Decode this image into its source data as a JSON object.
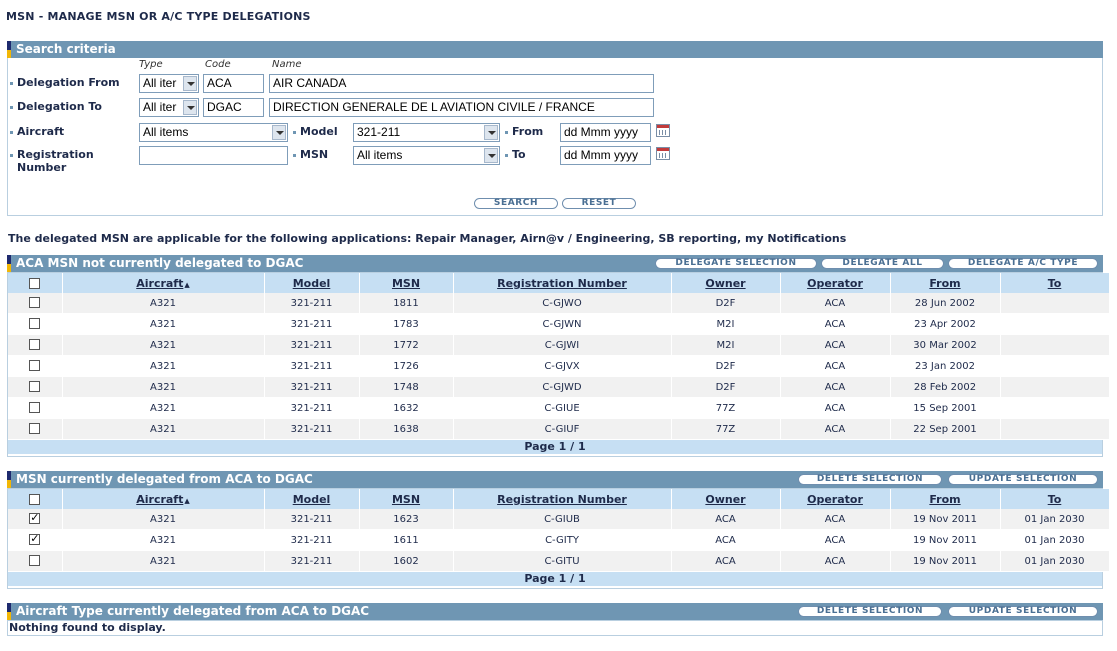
{
  "page_title": "MSN - MANAGE MSN OR A/C TYPE DELEGATIONS",
  "search": {
    "title": "Search criteria",
    "col_type": "Type",
    "col_code": "Code",
    "col_name": "Name",
    "delegation_from_label": "Delegation From",
    "delegation_from_type": "All iter",
    "delegation_from_code": "ACA",
    "delegation_from_name": "AIR CANADA",
    "delegation_to_label": "Delegation To",
    "delegation_to_type": "All iter",
    "delegation_to_code": "DGAC",
    "delegation_to_name": "DIRECTION GENERALE DE L AVIATION CIVILE / FRANCE",
    "aircraft_label": "Aircraft",
    "aircraft_value": "All items",
    "model_label": "Model",
    "model_value": "321-211",
    "from_label": "From",
    "from_placeholder": "dd Mmm yyyy",
    "registration_label_1": "Registration",
    "registration_label_2": "Number",
    "registration_value": "",
    "msn_label": "MSN",
    "msn_value": "All items",
    "to_label": "To",
    "to_placeholder": "dd Mmm yyyy",
    "search_button": "SEARCH",
    "reset_button": "RESET"
  },
  "note": "The delegated MSN are applicable for the following applications: Repair Manager, Airn@v / Engineering, SB reporting, my Notifications",
  "columns": [
    "Aircraft",
    "Model",
    "MSN",
    "Registration Number",
    "Owner",
    "Operator",
    "From",
    "To"
  ],
  "not_delegated": {
    "title": "ACA MSN not currently delegated to DGAC",
    "buttons": [
      "DELEGATE SELECTION",
      "DELEGATE ALL",
      "DELEGATE A/C TYPE"
    ],
    "rows": [
      {
        "checked": false,
        "cells": [
          "A321",
          "321-211",
          "1811",
          "C-GJWO",
          "D2F",
          "ACA",
          "28 Jun 2002",
          ""
        ]
      },
      {
        "checked": false,
        "cells": [
          "A321",
          "321-211",
          "1783",
          "C-GJWN",
          "M2I",
          "ACA",
          "23 Apr 2002",
          ""
        ]
      },
      {
        "checked": false,
        "cells": [
          "A321",
          "321-211",
          "1772",
          "C-GJWI",
          "M2I",
          "ACA",
          "30 Mar 2002",
          ""
        ]
      },
      {
        "checked": false,
        "cells": [
          "A321",
          "321-211",
          "1726",
          "C-GJVX",
          "D2F",
          "ACA",
          "23 Jan 2002",
          ""
        ]
      },
      {
        "checked": false,
        "cells": [
          "A321",
          "321-211",
          "1748",
          "C-GJWD",
          "D2F",
          "ACA",
          "28 Feb 2002",
          ""
        ]
      },
      {
        "checked": false,
        "cells": [
          "A321",
          "321-211",
          "1632",
          "C-GIUE",
          "77Z",
          "ACA",
          "15 Sep 2001",
          ""
        ]
      },
      {
        "checked": false,
        "cells": [
          "A321",
          "321-211",
          "1638",
          "C-GIUF",
          "77Z",
          "ACA",
          "22 Sep 2001",
          ""
        ]
      }
    ],
    "pager": "Page 1 / 1"
  },
  "delegated": {
    "title": "MSN currently delegated from ACA to DGAC",
    "buttons": [
      "DELETE SELECTION",
      "UPDATE SELECTION"
    ],
    "rows": [
      {
        "checked": true,
        "cells": [
          "A321",
          "321-211",
          "1623",
          "C-GIUB",
          "ACA",
          "ACA",
          "19 Nov 2011",
          "01 Jan 2030"
        ]
      },
      {
        "checked": true,
        "cells": [
          "A321",
          "321-211",
          "1611",
          "C-GITY",
          "ACA",
          "ACA",
          "19 Nov 2011",
          "01 Jan 2030"
        ]
      },
      {
        "checked": false,
        "cells": [
          "A321",
          "321-211",
          "1602",
          "C-GITU",
          "ACA",
          "ACA",
          "19 Nov 2011",
          "01 Jan 2030"
        ]
      }
    ],
    "pager": "Page 1 / 1"
  },
  "actype": {
    "title": "Aircraft Type currently delegated from ACA to DGAC",
    "buttons": [
      "DELETE SELECTION",
      "UPDATE SELECTION"
    ],
    "empty": "Nothing found to display."
  }
}
